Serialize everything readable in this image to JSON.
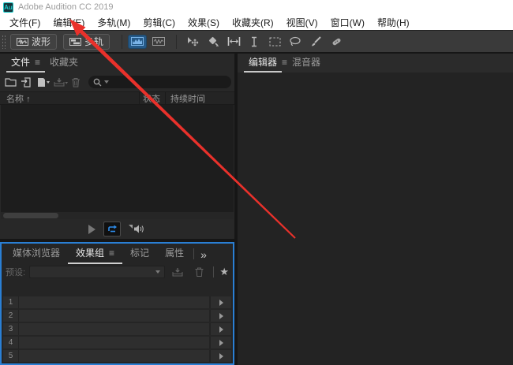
{
  "colors": {
    "accent_blue": "#2d8ceb",
    "focus_border": "#2a7fd4",
    "arrow_red": "#e9312b",
    "logo_teal": "#1ac8c8",
    "active_tool_bg": "#265a88"
  },
  "window": {
    "logo_text": "Au",
    "title": "Adobe Audition CC 2019"
  },
  "menu": {
    "items": [
      "文件(F)",
      "编辑(E)",
      "多轨(M)",
      "剪辑(C)",
      "效果(S)",
      "收藏夹(R)",
      "视图(V)",
      "窗口(W)",
      "帮助(H)"
    ]
  },
  "toolbar": {
    "waveform_button": "波形",
    "multitrack_button": "多轨"
  },
  "icons": {
    "hamburger": "≡",
    "sort_up": "↑",
    "chevron_more": "»",
    "star": "★"
  },
  "files_panel": {
    "tab_files": "文件",
    "tab_favorites": "收藏夹",
    "search_value": "",
    "col_name": "名称",
    "col_status": "状态",
    "col_duration": "持续时间"
  },
  "editor_panel": {
    "tab_editor": "编辑器",
    "tab_mixer": "混音器"
  },
  "bottom_panel": {
    "tab_media_browser": "媒体浏览器",
    "tab_effects_rack": "效果组",
    "tab_markers": "标记",
    "tab_properties": "属性",
    "preset_label": "预设:",
    "rack_rows": [
      "1",
      "2",
      "3",
      "4",
      "5"
    ]
  }
}
